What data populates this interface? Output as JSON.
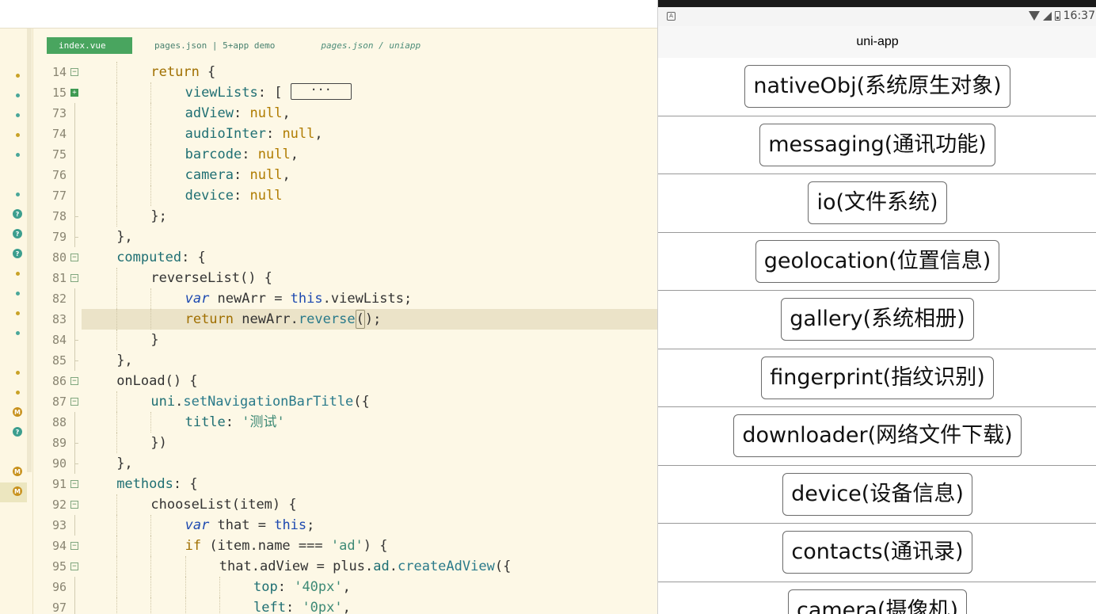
{
  "editor": {
    "tabs": [
      {
        "label": "index.vue",
        "active": true
      },
      {
        "label": "pages.json | 5+app demo",
        "active": false
      },
      {
        "label": "pages.json / uniapp",
        "active": false
      }
    ],
    "lines": [
      {
        "num": "14",
        "fold": "minus",
        "indent": 2,
        "tokens": [
          [
            "k",
            "return"
          ],
          [
            "d",
            " {"
          ]
        ]
      },
      {
        "num": "15",
        "fold": "plus",
        "indent": 3,
        "tokens": [
          [
            "p",
            "viewLists"
          ],
          [
            "d",
            ": ["
          ]
        ],
        "collapsed": " ··· "
      },
      {
        "num": "73",
        "fold": "line",
        "indent": 3,
        "tokens": [
          [
            "p",
            "adView"
          ],
          [
            "d",
            ": "
          ],
          [
            "n",
            "null"
          ],
          [
            "d",
            ","
          ]
        ]
      },
      {
        "num": "74",
        "fold": "line",
        "indent": 3,
        "tokens": [
          [
            "p",
            "audioInter"
          ],
          [
            "d",
            ": "
          ],
          [
            "n",
            "null"
          ],
          [
            "d",
            ","
          ]
        ]
      },
      {
        "num": "75",
        "fold": "line",
        "indent": 3,
        "tokens": [
          [
            "p",
            "barcode"
          ],
          [
            "d",
            ": "
          ],
          [
            "n",
            "null"
          ],
          [
            "d",
            ","
          ]
        ]
      },
      {
        "num": "76",
        "fold": "line",
        "indent": 3,
        "tokens": [
          [
            "p",
            "camera"
          ],
          [
            "d",
            ": "
          ],
          [
            "n",
            "null"
          ],
          [
            "d",
            ","
          ]
        ]
      },
      {
        "num": "77",
        "fold": "line",
        "indent": 3,
        "tokens": [
          [
            "p",
            "device"
          ],
          [
            "d",
            ": "
          ],
          [
            "n",
            "null"
          ]
        ]
      },
      {
        "num": "78",
        "fold": "end",
        "indent": 2,
        "tokens": [
          [
            "d",
            "};"
          ]
        ]
      },
      {
        "num": "79",
        "fold": "end",
        "indent": 1,
        "tokens": [
          [
            "d",
            "},"
          ]
        ]
      },
      {
        "num": "80",
        "fold": "minus",
        "indent": 1,
        "tokens": [
          [
            "p",
            "computed"
          ],
          [
            "d",
            ": {"
          ]
        ]
      },
      {
        "num": "81",
        "fold": "minus",
        "indent": 2,
        "tokens": [
          [
            "d",
            "reverseList() {"
          ]
        ]
      },
      {
        "num": "82",
        "fold": "line",
        "indent": 3,
        "tokens": [
          [
            "v",
            "var"
          ],
          [
            "d",
            " newArr = "
          ],
          [
            "b",
            "this"
          ],
          [
            "d",
            ".viewLists;"
          ]
        ]
      },
      {
        "num": "83",
        "fold": "line",
        "indent": 3,
        "highlight": true,
        "tokens": [
          [
            "k",
            "return"
          ],
          [
            "d",
            " newArr."
          ],
          [
            "m",
            "reverse"
          ],
          [
            "cur",
            "()"
          ],
          [
            "d",
            ";"
          ]
        ]
      },
      {
        "num": "84",
        "fold": "end",
        "indent": 2,
        "tokens": [
          [
            "d",
            "}"
          ]
        ]
      },
      {
        "num": "85",
        "fold": "end",
        "indent": 1,
        "tokens": [
          [
            "d",
            "},"
          ]
        ]
      },
      {
        "num": "86",
        "fold": "minus",
        "indent": 1,
        "tokens": [
          [
            "d",
            "onLoad() {"
          ]
        ]
      },
      {
        "num": "87",
        "fold": "minus",
        "indent": 2,
        "tokens": [
          [
            "p",
            "uni"
          ],
          [
            "d",
            "."
          ],
          [
            "m",
            "setNavigationBarTitle"
          ],
          [
            "d",
            "({"
          ]
        ]
      },
      {
        "num": "88",
        "fold": "line",
        "indent": 3,
        "tokens": [
          [
            "p",
            "title"
          ],
          [
            "d",
            ": "
          ],
          [
            "s",
            "'测试'"
          ]
        ]
      },
      {
        "num": "89",
        "fold": "end",
        "indent": 2,
        "tokens": [
          [
            "d",
            "})"
          ]
        ]
      },
      {
        "num": "90",
        "fold": "end",
        "indent": 1,
        "tokens": [
          [
            "d",
            "},"
          ]
        ]
      },
      {
        "num": "91",
        "fold": "minus",
        "indent": 1,
        "tokens": [
          [
            "p",
            "methods"
          ],
          [
            "d",
            ": {"
          ]
        ]
      },
      {
        "num": "92",
        "fold": "minus",
        "indent": 2,
        "tokens": [
          [
            "d",
            "chooseList(item) {"
          ]
        ]
      },
      {
        "num": "93",
        "fold": "line",
        "indent": 3,
        "tokens": [
          [
            "v",
            "var"
          ],
          [
            "d",
            " that = "
          ],
          [
            "b",
            "this"
          ],
          [
            "d",
            ";"
          ]
        ]
      },
      {
        "num": "94",
        "fold": "minus",
        "indent": 3,
        "tokens": [
          [
            "k",
            "if"
          ],
          [
            "d",
            " (item.name === "
          ],
          [
            "s",
            "'ad'"
          ],
          [
            "d",
            ") {"
          ]
        ]
      },
      {
        "num": "95",
        "fold": "minus",
        "indent": 4,
        "tokens": [
          [
            "d",
            "that.adView = plus."
          ],
          [
            "p",
            "ad"
          ],
          [
            "d",
            "."
          ],
          [
            "m",
            "createAdView"
          ],
          [
            "d",
            "({"
          ]
        ]
      },
      {
        "num": "96",
        "fold": "line",
        "indent": 5,
        "tokens": [
          [
            "p",
            "top"
          ],
          [
            "d",
            ": "
          ],
          [
            "s",
            "'40px'"
          ],
          [
            "d",
            ","
          ]
        ]
      },
      {
        "num": "97",
        "fold": "line",
        "indent": 5,
        "tokens": [
          [
            "p",
            "left"
          ],
          [
            "d",
            ": "
          ],
          [
            "s",
            "'0px'"
          ],
          [
            "d",
            ","
          ]
        ]
      }
    ],
    "rail_markers": [
      {
        "kind": "dot-y"
      },
      {
        "kind": "dot-t"
      },
      {
        "kind": "dot-t"
      },
      {
        "kind": "dot-y"
      },
      {
        "kind": "dot-t"
      },
      {
        "kind": "none"
      },
      {
        "kind": "dot-t"
      },
      {
        "kind": "q",
        "text": "?"
      },
      {
        "kind": "q",
        "text": "?"
      },
      {
        "kind": "q",
        "text": "?"
      },
      {
        "kind": "dot-y"
      },
      {
        "kind": "dot-t"
      },
      {
        "kind": "dot-y"
      },
      {
        "kind": "dot-t"
      },
      {
        "kind": "none"
      },
      {
        "kind": "dot-y"
      },
      {
        "kind": "dot-y"
      },
      {
        "kind": "m",
        "text": "M"
      },
      {
        "kind": "q",
        "text": "?"
      },
      {
        "kind": "none"
      },
      {
        "kind": "m",
        "text": "M"
      },
      {
        "kind": "m",
        "text": "M"
      }
    ]
  },
  "phone": {
    "status_time": "16:37",
    "status_app_glyph": "A",
    "nav_title": "uni-app",
    "items": [
      "nativeObj(系统原生对象)",
      "messaging(通讯功能)",
      "io(文件系统)",
      "geolocation(位置信息)",
      "gallery(系统相册)",
      "fingerprint(指纹识别)",
      "downloader(网络文件下载)",
      "device(设备信息)",
      "contacts(通讯录)",
      "camera(摄像机)"
    ]
  }
}
